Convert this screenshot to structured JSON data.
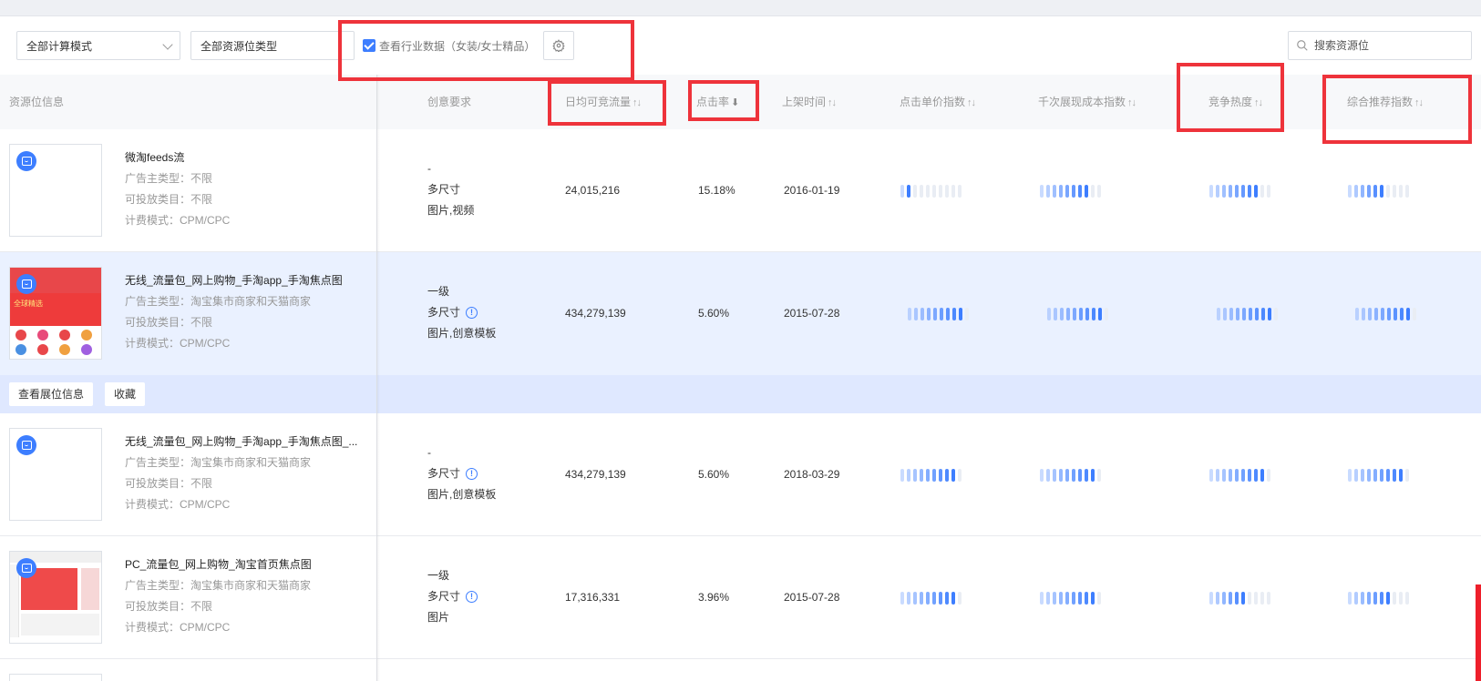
{
  "filters": {
    "calc_mode": "全部计算模式",
    "resource_type": "全部资源位类型",
    "industry_label": "查看行业数据（女装/女士精品）",
    "search_placeholder": "搜索资源位"
  },
  "headers": {
    "info": "资源位信息",
    "creative": "创意要求",
    "traffic": "日均可竞流量",
    "ctr": "点击率",
    "date": "上架时间",
    "cpc": "点击单价指数",
    "cpm": "千次展现成本指数",
    "heat": "竞争热度",
    "reco": "综合推荐指数"
  },
  "sort_glyphs": {
    "both": "↑↓",
    "down": "⬇"
  },
  "icons": {
    "gear": "gear-icon",
    "search": "search-icon",
    "badge": "shopping-bag-icon",
    "info": "info-icon"
  },
  "colors": {
    "accent": "#3d7eff",
    "bar_off": "#e9edf4",
    "row_highlight": "#eaf1ff",
    "action_bar": "#dfe8ff",
    "annotation": "#ee333b"
  },
  "actions": {
    "view": "查看展位信息",
    "fav": "收藏"
  },
  "rows": [
    {
      "title": "微淘feeds流",
      "advertiser": "广告主类型：不限",
      "category": "可投放类目：不限",
      "billing": "计费模式：CPM/CPC",
      "creative": [
        "-",
        "多尺寸",
        "图片,视频"
      ],
      "creative_info": false,
      "traffic": "24,015,216",
      "ctr": "15.18%",
      "date": "2016-01-19",
      "cpc_level": 0.2,
      "cpm_level": 0.8,
      "heat_level": 0.8,
      "reco_level": 0.6
    },
    {
      "title": "无线_流量包_网上购物_手淘app_手淘焦点图",
      "advertiser": "广告主类型：淘宝集市商家和天猫商家",
      "category": "可投放类目：不限",
      "billing": "计费模式：CPM/CPC",
      "creative": [
        "一级",
        "多尺寸",
        "图片,创意模板"
      ],
      "creative_info": true,
      "traffic": "434,279,139",
      "ctr": "5.60%",
      "date": "2015-07-28",
      "cpc_level": 0.9,
      "cpm_level": 0.9,
      "heat_level": 0.9,
      "reco_level": 0.9
    },
    {
      "title": "无线_流量包_网上购物_手淘app_手淘焦点图_...",
      "advertiser": "广告主类型：淘宝集市商家和天猫商家",
      "category": "可投放类目：不限",
      "billing": "计费模式：CPM/CPC",
      "creative": [
        "-",
        "多尺寸",
        "图片,创意模板"
      ],
      "creative_info": true,
      "traffic": "434,279,139",
      "ctr": "5.60%",
      "date": "2018-03-29",
      "cpc_level": 0.9,
      "cpm_level": 0.9,
      "heat_level": 0.9,
      "reco_level": 0.9
    },
    {
      "title": "PC_流量包_网上购物_淘宝首页焦点图",
      "advertiser": "广告主类型：淘宝集市商家和天猫商家",
      "category": "可投放类目：不限",
      "billing": "计费模式：CPM/CPC",
      "creative": [
        "一级",
        "多尺寸",
        "图片"
      ],
      "creative_info": true,
      "traffic": "17,316,331",
      "ctr": "3.96%",
      "date": "2015-07-28",
      "cpc_level": 0.9,
      "cpm_level": 0.9,
      "heat_level": 0.6,
      "reco_level": 0.7
    }
  ]
}
